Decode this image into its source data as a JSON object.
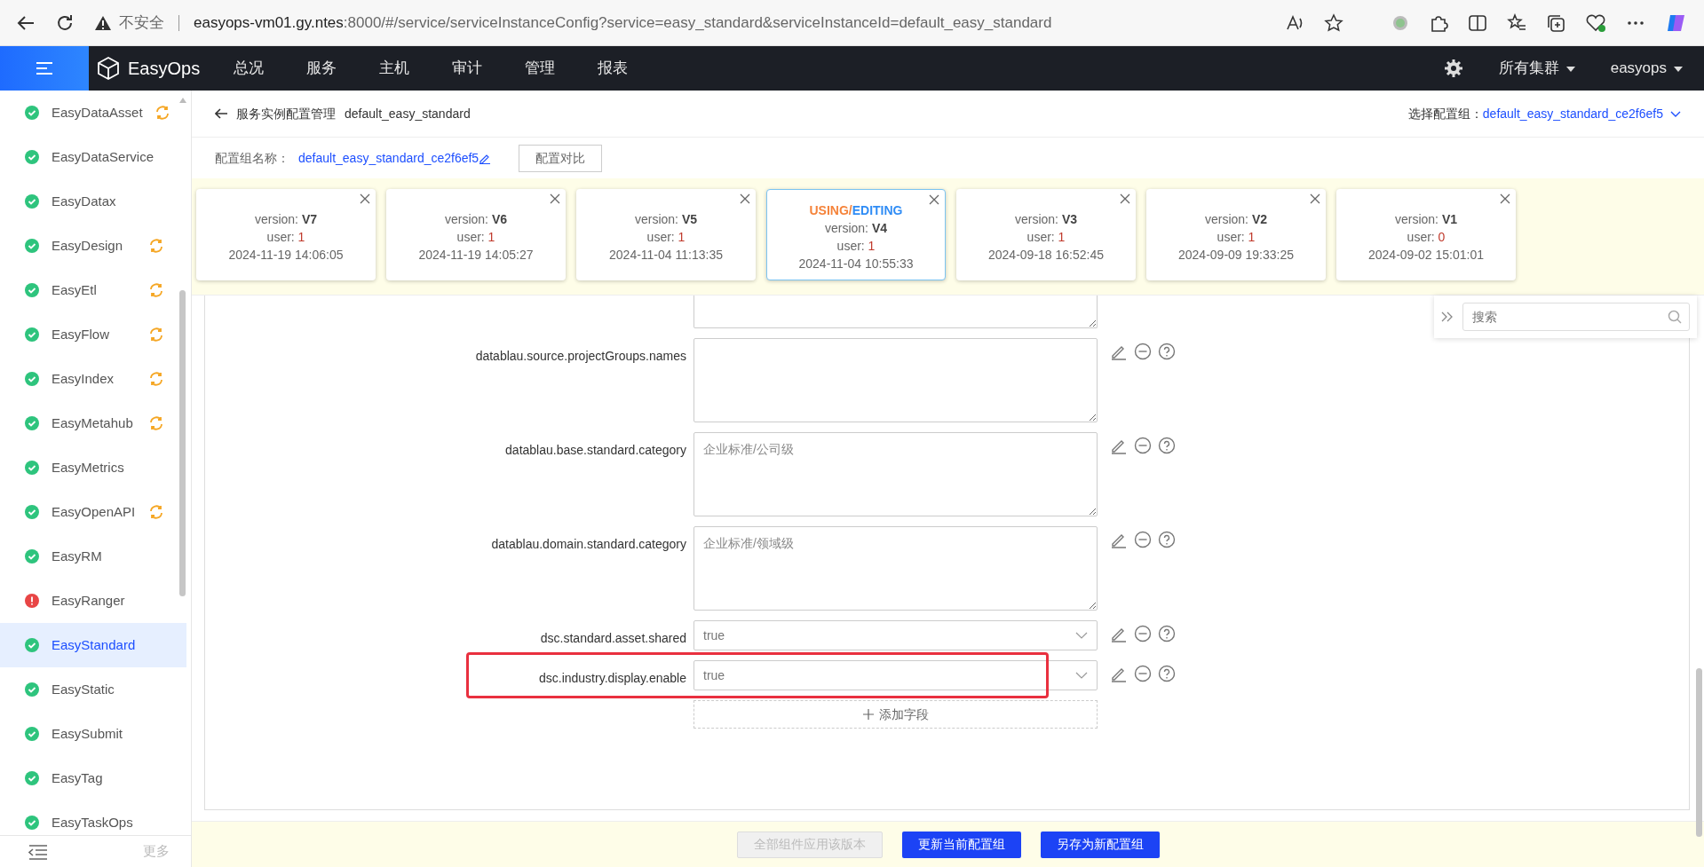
{
  "browser": {
    "insecure_label": "不安全",
    "url_host": "easyops-vm01.gy.ntes",
    "url_path": ":8000/#/service/serviceInstanceConfig?service=easy_standard&serviceInstanceId=default_easy_standard"
  },
  "navbar": {
    "brand": "EasyOps",
    "menu": [
      "总况",
      "服务",
      "主机",
      "审计",
      "管理",
      "报表"
    ],
    "cluster": "所有集群",
    "user": "easyops"
  },
  "sidebar": {
    "items": [
      {
        "name": "EasyDataAsset",
        "error": false,
        "syncing": true,
        "selected": false
      },
      {
        "name": "EasyDataService",
        "error": false,
        "syncing": false,
        "selected": false
      },
      {
        "name": "EasyDatax",
        "error": false,
        "syncing": false,
        "selected": false
      },
      {
        "name": "EasyDesign",
        "error": false,
        "syncing": true,
        "selected": false
      },
      {
        "name": "EasyEtl",
        "error": false,
        "syncing": true,
        "selected": false
      },
      {
        "name": "EasyFlow",
        "error": false,
        "syncing": true,
        "selected": false
      },
      {
        "name": "EasyIndex",
        "error": false,
        "syncing": true,
        "selected": false
      },
      {
        "name": "EasyMetahub",
        "error": false,
        "syncing": true,
        "selected": false
      },
      {
        "name": "EasyMetrics",
        "error": false,
        "syncing": false,
        "selected": false
      },
      {
        "name": "EasyOpenAPI",
        "error": false,
        "syncing": true,
        "selected": false
      },
      {
        "name": "EasyRM",
        "error": false,
        "syncing": false,
        "selected": false
      },
      {
        "name": "EasyRanger",
        "error": true,
        "syncing": false,
        "selected": false
      },
      {
        "name": "EasyStandard",
        "error": false,
        "syncing": false,
        "selected": true
      },
      {
        "name": "EasyStatic",
        "error": false,
        "syncing": false,
        "selected": false
      },
      {
        "name": "EasySubmit",
        "error": false,
        "syncing": false,
        "selected": false
      },
      {
        "name": "EasyTag",
        "error": false,
        "syncing": false,
        "selected": false
      },
      {
        "name": "EasyTaskOps",
        "error": false,
        "syncing": false,
        "selected": false
      }
    ],
    "more": "更多"
  },
  "header": {
    "title": "服务实例配置管理",
    "instance": "default_easy_standard",
    "selector_label": "选择配置组：",
    "selector_value": "default_easy_standard_ce2f6ef5"
  },
  "config_group": {
    "label": "配置组名称：",
    "name": "default_easy_standard_ce2f6ef5",
    "compare_button": "配置对比"
  },
  "versions": [
    {
      "version_label": "version:",
      "version": "V7",
      "user_label": "user:",
      "user": "1",
      "time": "2024-11-19 14:06:05",
      "current": false
    },
    {
      "version_label": "version:",
      "version": "V6",
      "user_label": "user:",
      "user": "1",
      "time": "2024-11-19 14:05:27",
      "current": false
    },
    {
      "version_label": "version:",
      "version": "V5",
      "user_label": "user:",
      "user": "1",
      "time": "2024-11-04 11:13:35",
      "current": false
    },
    {
      "version_label": "version:",
      "version": "V4",
      "user_label": "user:",
      "user": "1",
      "time": "2024-11-04 10:55:33",
      "current": true,
      "status_using": "USING",
      "status_sep": "/",
      "status_editing": "EDITING"
    },
    {
      "version_label": "version:",
      "version": "V3",
      "user_label": "user:",
      "user": "1",
      "time": "2024-09-18 16:52:45",
      "current": false
    },
    {
      "version_label": "version:",
      "version": "V2",
      "user_label": "user:",
      "user": "1",
      "time": "2024-09-09 19:33:25",
      "current": false
    },
    {
      "version_label": "version:",
      "version": "V1",
      "user_label": "user:",
      "user": "0",
      "time": "2024-09-02 15:01:01",
      "current": false
    }
  ],
  "fields": [
    {
      "kind": "textarea_partial",
      "highlighted": false
    },
    {
      "kind": "textarea",
      "label": "datablau.source.projectGroups.names",
      "highlighted": false
    },
    {
      "kind": "textarea",
      "label": "datablau.base.standard.category",
      "value": "企业标准/公司级",
      "highlighted": false
    },
    {
      "kind": "textarea",
      "label": "datablau.domain.standard.category",
      "value": "企业标准/领域级",
      "highlighted": false
    },
    {
      "kind": "select",
      "label": "dsc.standard.asset.shared",
      "value": "true",
      "highlighted": false
    },
    {
      "kind": "select",
      "label": "dsc.industry.display.enable",
      "value": "true",
      "highlighted": true
    }
  ],
  "add_field": "添加字段",
  "search": {
    "placeholder": "搜索"
  },
  "buttons": [
    {
      "label": "全部组件应用该版本",
      "disabled": true
    },
    {
      "label": "更新当前配置组",
      "disabled": false
    },
    {
      "label": "另存为新配置组",
      "disabled": false
    }
  ]
}
